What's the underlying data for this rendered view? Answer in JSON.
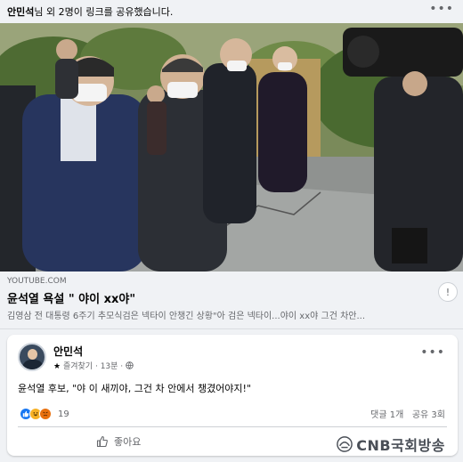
{
  "share_header": {
    "actor": "안민석",
    "rest": "님 외 2명이 링크를 공유했습니다."
  },
  "link_card": {
    "source": "YOUTUBE.COM",
    "title": "윤석열 욕설 \" 야이 xx야\"",
    "description": "김영삼 전 대통령 6주기 추모식검은 넥타이 안챙긴 상황\"아 검은 넥타이...야이 xx야 그건 차안..."
  },
  "post": {
    "author": "안민석",
    "meta_favorites": "즐겨찾기",
    "meta_time": "13분",
    "text": "윤석열 후보, \"야 이 새끼야, 그건 차 안에서 챙겼어야지!\"",
    "reaction_count": "19",
    "comments": "댓글 1개",
    "shares": "공유 3회",
    "like_label": "좋아요"
  },
  "watermark": {
    "text": "CNB국회방송"
  },
  "icons": {
    "more": "more-horizontal-icon",
    "globe": "globe-icon",
    "like": "thumbs-up-icon"
  },
  "colors": {
    "facebook_blue": "#1877f2",
    "background": "#f0f2f5",
    "secondary_text": "#65676b"
  }
}
